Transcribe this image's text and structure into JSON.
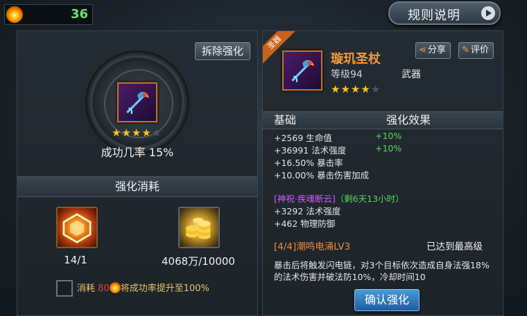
{
  "top": {
    "currency_amount": "36",
    "rules_label": "规则说明"
  },
  "left": {
    "remove_label": "拆除强化",
    "item_stars": {
      "filled": 4,
      "total": 5
    },
    "success_rate": "成功几率 15%",
    "cost_header": "强化消耗",
    "material1_count": "14/1",
    "material2_count": "4068万/10000",
    "consume": {
      "pre": "消耗 ",
      "amount": "80",
      "post": "将成功率提升至100%"
    }
  },
  "right": {
    "ribbon": "圣器",
    "item_name": "璇玑圣杖",
    "item_level": "等级94",
    "item_type": "武器",
    "item_stars": {
      "filled": 4,
      "total": 5
    },
    "share_label": "分享",
    "review_label": "评价",
    "col_base": "基础",
    "col_effect": "强化效果",
    "stats": [
      {
        "text": "+2569 生命值",
        "bonus": "+10%"
      },
      {
        "text": "+36991 法术强度",
        "bonus": "+10%"
      },
      {
        "text": "+16.50% 暴击率",
        "bonus": ""
      },
      {
        "text": "+10.00% 暴击伤害加成",
        "bonus": ""
      }
    ],
    "blessing": {
      "name": "[神祝·疾魂断云]",
      "remaining": "（剩6天13小时）"
    },
    "blessing_stats": [
      "+3292 法术强度",
      "+462 物理防御"
    ],
    "level_title": "[4/4]潮鸣电涌LV3",
    "level_status": "已达到最高级",
    "description": "暴击后将触发闪电链，对3个目标依次造成自身法强18%的法术伤害并破法防10%，冷却时间10"
  },
  "confirm_label": "确认强化",
  "colors": {
    "item_name": "#f39a3a",
    "bonus": "#57d957",
    "blessing": "#d05cff",
    "star": "#ffc21c",
    "accent": "#c9621a"
  }
}
